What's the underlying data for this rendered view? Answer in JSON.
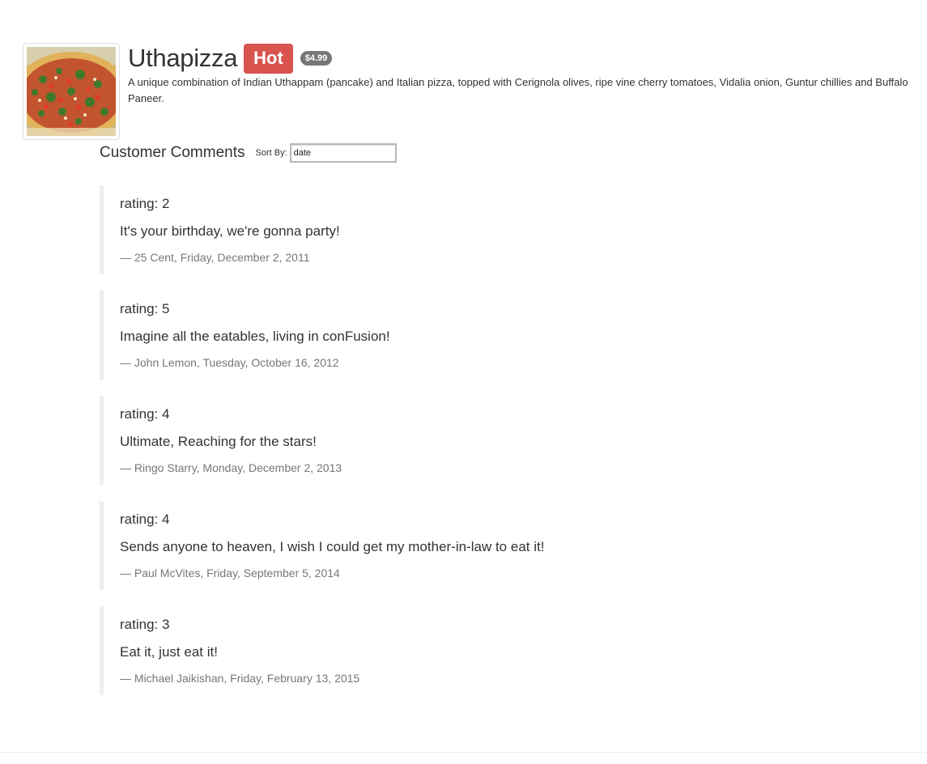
{
  "dish": {
    "name": "Uthapizza",
    "label": "Hot",
    "price": "$4.99",
    "description": "A unique combination of Indian Uthappam (pancake) and Italian pizza, topped with Cerignola olives, ripe vine cherry tomatoes, Vidalia onion, Guntur chillies and Buffalo Paneer.",
    "image_icon": "pizza-image",
    "label_color": "#d9534f",
    "price_badge_color": "#777777"
  },
  "comments_section": {
    "title": "Customer Comments",
    "sort_label": "Sort By:",
    "sort_value": "date"
  },
  "comments": [
    {
      "rating": "rating: 2",
      "text": "It's your birthday, we're gonna party!",
      "footer": "— 25 Cent, Friday, December 2, 2011"
    },
    {
      "rating": "rating: 5",
      "text": "Imagine all the eatables, living in conFusion!",
      "footer": "— John Lemon, Tuesday, October 16, 2012"
    },
    {
      "rating": "rating: 4",
      "text": "Ultimate, Reaching for the stars!",
      "footer": "— Ringo Starry, Monday, December 2, 2013"
    },
    {
      "rating": "rating: 4",
      "text": "Sends anyone to heaven, I wish I could get my mother-in-law to eat it!",
      "footer": "— Paul McVites, Friday, September 5, 2014"
    },
    {
      "rating": "rating: 3",
      "text": "Eat it, just eat it!",
      "footer": "— Michael Jaikishan, Friday, February 13, 2015"
    }
  ]
}
